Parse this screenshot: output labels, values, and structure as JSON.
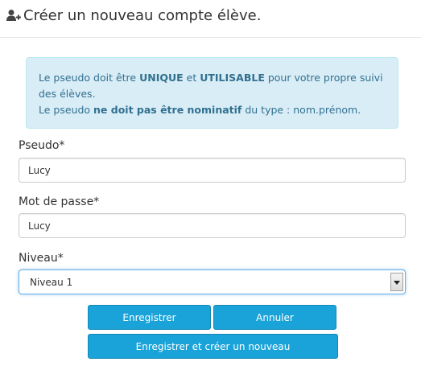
{
  "header": {
    "icon": "add-user-icon",
    "title": "Créer un nouveau compte élève."
  },
  "alert": {
    "line1_pre": "Le pseudo doit être ",
    "line1_bold1": "UNIQUE",
    "line1_mid": " et ",
    "line1_bold2": "UTILISABLE",
    "line1_post": " pour votre propre suivi des élèves.",
    "line2_pre": "Le pseudo ",
    "line2_bold": "ne doit pas être nominatif",
    "line2_post": " du type : nom.prénom."
  },
  "form": {
    "pseudo_label": "Pseudo*",
    "pseudo_value": "Lucy",
    "password_label": "Mot de passe*",
    "password_value": "Lucy",
    "level_label": "Niveau*",
    "level_selected": "Niveau 1"
  },
  "buttons": {
    "save": "Enregistrer",
    "cancel": "Annuler",
    "save_and_new": "Enregistrer et créer un nouveau"
  },
  "colors": {
    "button_bg": "#1aa3d9",
    "alert_bg": "#d9edf7",
    "alert_text": "#31708f"
  }
}
